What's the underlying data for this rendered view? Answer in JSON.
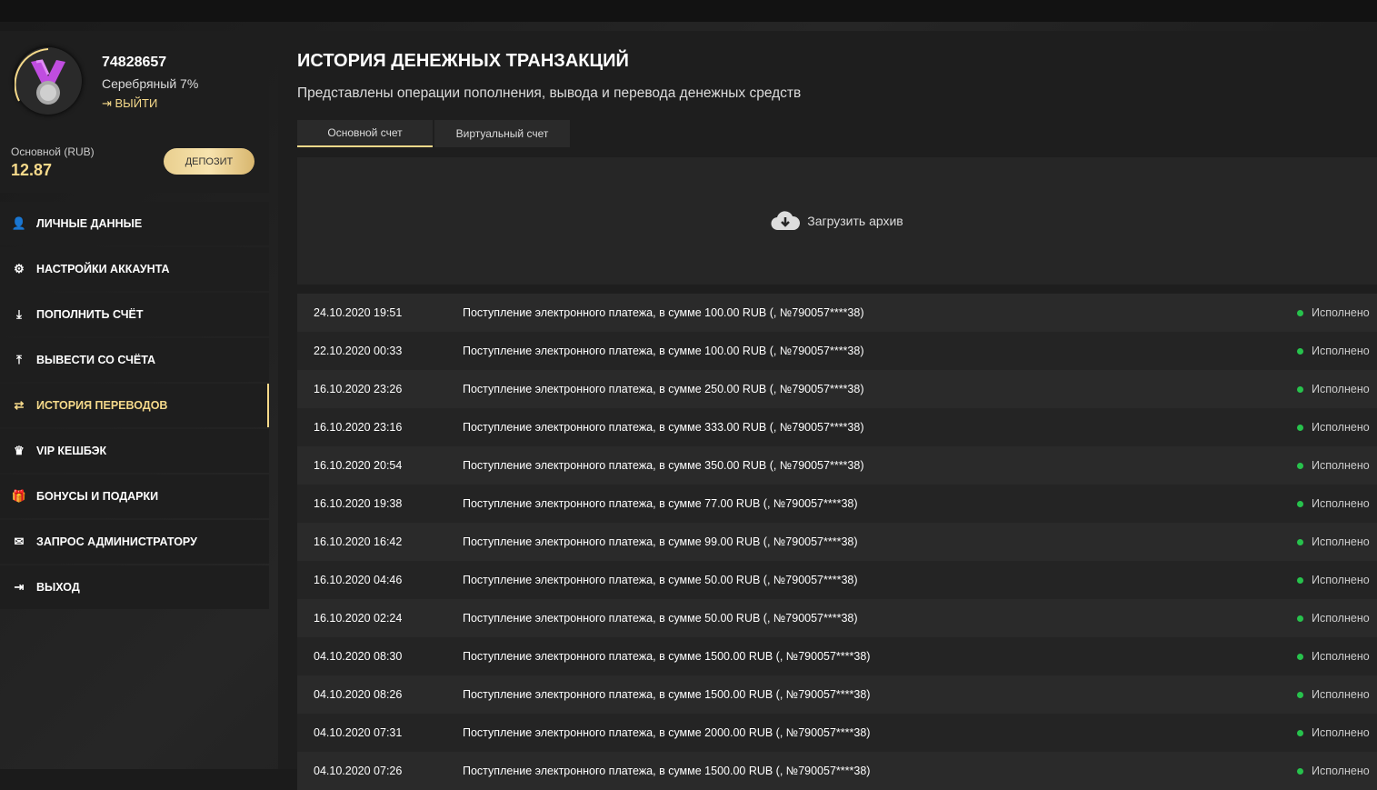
{
  "profile": {
    "user_id": "74828657",
    "rank": "Серебряный 7%",
    "logout": "ВЫЙТИ",
    "balance_label": "Основной (RUB)",
    "balance": "12.87",
    "deposit": "ДЕПОЗИТ"
  },
  "menu": [
    {
      "icon": "user-plus-icon",
      "glyph": "👤",
      "label": "ЛИЧНЫЕ ДАННЫЕ"
    },
    {
      "icon": "gears-icon",
      "glyph": "⚙",
      "label": "НАСТРОЙКИ АККАУНТА"
    },
    {
      "icon": "download-icon",
      "glyph": "⤓",
      "label": "ПОПОЛНИТЬ СЧЁТ"
    },
    {
      "icon": "upload-icon",
      "glyph": "⤒",
      "label": "ВЫВЕСТИ СО СЧЁТА"
    },
    {
      "icon": "exchange-icon",
      "glyph": "⇄",
      "label": "ИСТОРИЯ ПЕРЕВОДОВ",
      "active": true
    },
    {
      "icon": "crown-icon",
      "glyph": "♛",
      "label": "VIP КЕШБЭК"
    },
    {
      "icon": "gift-icon",
      "glyph": "🎁",
      "label": "БОНУСЫ И ПОДАРКИ"
    },
    {
      "icon": "envelope-icon",
      "glyph": "✉",
      "label": "ЗАПРОС АДМИНИСТРАТОРУ"
    },
    {
      "icon": "sign-out-icon",
      "glyph": "⇥",
      "label": "ВЫХОД"
    }
  ],
  "main": {
    "title": "ИСТОРИЯ ДЕНЕЖНЫХ ТРАНЗАКЦИЙ",
    "subtitle": "Представлены операции пополнения, вывода и перевода денежных средств",
    "tabs": [
      "Основной счет",
      "Виртуальный счет"
    ],
    "archive": "Загрузить архив"
  },
  "accent": "#f5d98a",
  "transactions": [
    {
      "date": "24.10.2020 19:51",
      "text": "Поступление электронного платежа, в сумме 100.00 RUB (, №790057****38)",
      "status": "Исполнено"
    },
    {
      "date": "22.10.2020 00:33",
      "text": "Поступление электронного платежа, в сумме 100.00 RUB (, №790057****38)",
      "status": "Исполнено"
    },
    {
      "date": "16.10.2020 23:26",
      "text": "Поступление электронного платежа, в сумме 250.00 RUB (, №790057****38)",
      "status": "Исполнено"
    },
    {
      "date": "16.10.2020 23:16",
      "text": "Поступление электронного платежа, в сумме 333.00 RUB (, №790057****38)",
      "status": "Исполнено"
    },
    {
      "date": "16.10.2020 20:54",
      "text": "Поступление электронного платежа, в сумме 350.00 RUB (, №790057****38)",
      "status": "Исполнено"
    },
    {
      "date": "16.10.2020 19:38",
      "text": "Поступление электронного платежа, в сумме 77.00 RUB (, №790057****38)",
      "status": "Исполнено"
    },
    {
      "date": "16.10.2020 16:42",
      "text": "Поступление электронного платежа, в сумме 99.00 RUB (, №790057****38)",
      "status": "Исполнено"
    },
    {
      "date": "16.10.2020 04:46",
      "text": "Поступление электронного платежа, в сумме 50.00 RUB (, №790057****38)",
      "status": "Исполнено"
    },
    {
      "date": "16.10.2020 02:24",
      "text": "Поступление электронного платежа, в сумме 50.00 RUB (, №790057****38)",
      "status": "Исполнено"
    },
    {
      "date": "04.10.2020 08:30",
      "text": "Поступление электронного платежа, в сумме 1500.00 RUB (, №790057****38)",
      "status": "Исполнено"
    },
    {
      "date": "04.10.2020 08:26",
      "text": "Поступление электронного платежа, в сумме 1500.00 RUB (, №790057****38)",
      "status": "Исполнено"
    },
    {
      "date": "04.10.2020 07:31",
      "text": "Поступление электронного платежа, в сумме 2000.00 RUB (, №790057****38)",
      "status": "Исполнено"
    },
    {
      "date": "04.10.2020 07:26",
      "text": "Поступление электронного платежа, в сумме 1500.00 RUB (, №790057****38)",
      "status": "Исполнено"
    }
  ]
}
